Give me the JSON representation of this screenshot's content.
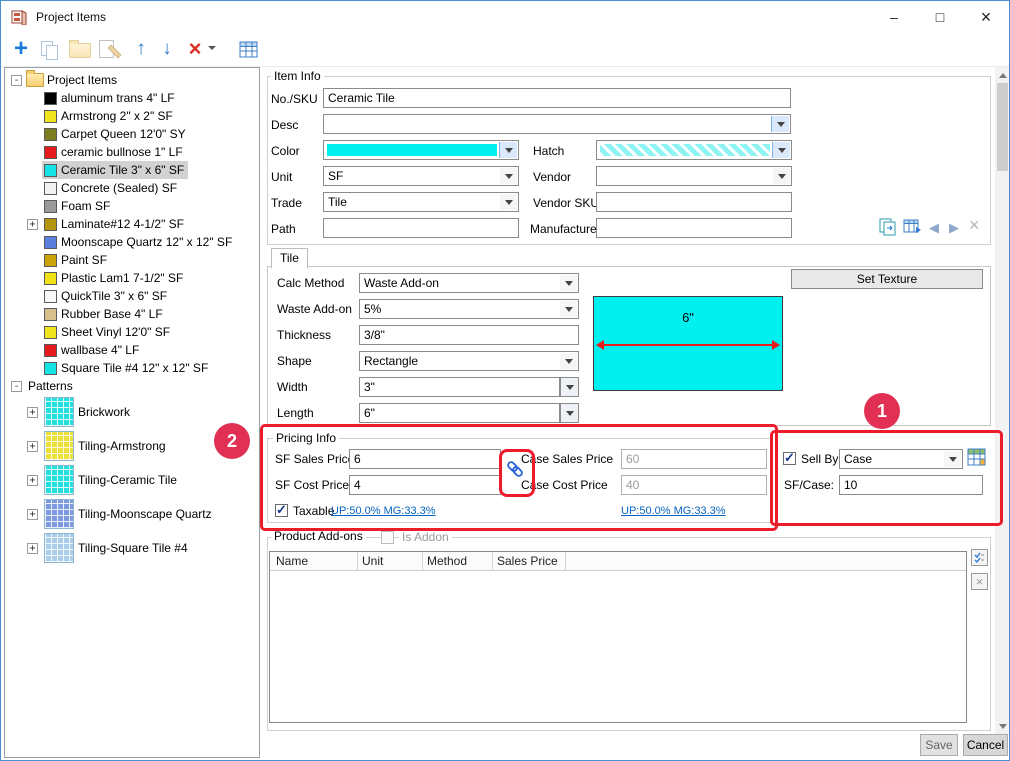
{
  "window": {
    "title": "Project Items"
  },
  "titlebar": {
    "minimize_glyph": "–",
    "maximize_glyph": "□",
    "close_glyph": "×"
  },
  "toolbar": {
    "add_glyph": "+",
    "up_glyph": "↑",
    "down_glyph": "↓",
    "delete_glyph": "×"
  },
  "tree": {
    "root_label": "Project Items",
    "patterns_label": "Patterns",
    "collapse_glyph": "-",
    "expand_glyph": "+",
    "items": [
      {
        "label": "aluminum trans 4\" LF",
        "color": "#000000"
      },
      {
        "label": "Armstrong 2\" x 2\" SF",
        "color": "#f0e51c"
      },
      {
        "label": "Carpet Queen 12'0\" SY",
        "color": "#7d7d22"
      },
      {
        "label": "ceramic bullnose 1\" LF",
        "color": "#e51a1f"
      },
      {
        "label": "Ceramic Tile 3\" x 6\" SF",
        "color": "#16e4e4"
      },
      {
        "label": "Concrete (Sealed)  SF",
        "color": "#f2f2f2"
      },
      {
        "label": "Foam  SF",
        "color": "#9a9a9a"
      },
      {
        "label": "Laminate#12 4-1/2\" SF",
        "color": "#b5950f"
      },
      {
        "label": "Moonscape Quartz 12\" x 12\" SF",
        "color": "#5b7fdd"
      },
      {
        "label": "Paint  SF",
        "color": "#c9a40b"
      },
      {
        "label": "Plastic Lam1 7-1/2\" SF",
        "color": "#efe318"
      },
      {
        "label": "QuickTile 3\" x 6\" SF",
        "color": "#f7f7f7"
      },
      {
        "label": "Rubber Base 4\" LF",
        "color": "#d8c08e"
      },
      {
        "label": "Sheet Vinyl 12'0\" SF",
        "color": "#f0e51c"
      },
      {
        "label": "wallbase 4\" LF",
        "color": "#e51a1f"
      },
      {
        "label": "Square Tile #4 12\" x 12\" SF",
        "color": "#16e4e4"
      }
    ],
    "patterns": [
      {
        "label": "Brickwork",
        "color": "#25dede"
      },
      {
        "label": "Tiling-Armstrong",
        "color": "#ece13a"
      },
      {
        "label": "Tiling-Ceramic Tile",
        "color": "#25dede"
      },
      {
        "label": "Tiling-Moonscape Quartz",
        "color": "#7d99e0"
      },
      {
        "label": "Tiling-Square Tile #4",
        "color": "#a9cdeb"
      }
    ]
  },
  "item_info": {
    "section_label": "Item Info",
    "sku_label": "No./SKU",
    "sku_value": "Ceramic Tile",
    "desc_label": "Desc",
    "color_label": "Color",
    "hatch_label": "Hatch",
    "unit_label": "Unit",
    "unit_value": "SF",
    "vendor_label": "Vendor",
    "trade_label": "Trade",
    "trade_value": "Tile",
    "vendor_sku_label": "Vendor SKU",
    "path_label": "Path",
    "manufacturer_label": "Manufacturer"
  },
  "tile": {
    "tab_label": "Tile",
    "calc_method_label": "Calc Method",
    "calc_method_value": "Waste Add-on",
    "waste_label": "Waste Add-on",
    "waste_value": "5%",
    "thickness_label": "Thickness",
    "thickness_value": "3/8\"",
    "shape_label": "Shape",
    "shape_value": "Rectangle",
    "width_label": "Width",
    "width_value": "3\"",
    "length_label": "Length",
    "length_value": "6\"",
    "set_texture_label": "Set Texture",
    "preview_dimension": "6\""
  },
  "pricing": {
    "section_label": "Pricing Info",
    "sf_sales_label": "SF Sales Price",
    "sf_sales_value": "6",
    "sf_cost_label": "SF Cost Price",
    "sf_cost_value": "4",
    "case_sales_label": "Case Sales Price",
    "case_sales_value": "60",
    "case_cost_label": "Case Cost Price",
    "case_cost_value": "40",
    "taxable_label": "Taxable",
    "sf_margin": "UP:50.0% MG:33.3%",
    "case_margin": "UP:50.0% MG:33.3%"
  },
  "sell_by": {
    "label": "Sell By",
    "value": "Case",
    "per_label": "SF/Case:",
    "per_value": "10"
  },
  "addons": {
    "section_label": "Product Add-ons",
    "is_addon_label": "Is Addon",
    "columns": [
      "Name",
      "Unit",
      "Method",
      "Sales Price"
    ]
  },
  "footer": {
    "save_label": "Save",
    "cancel_label": "Cancel"
  },
  "annotations": {
    "step1": "1",
    "step2": "2"
  },
  "colors": {
    "cyan": "#00f0f0",
    "hatch_base": "#8df3f3",
    "annotation_red": "#ed1c2b",
    "badge_red": "#e23055",
    "dim_red": "#e81a1a",
    "accent_blue": "#2a62d8"
  }
}
